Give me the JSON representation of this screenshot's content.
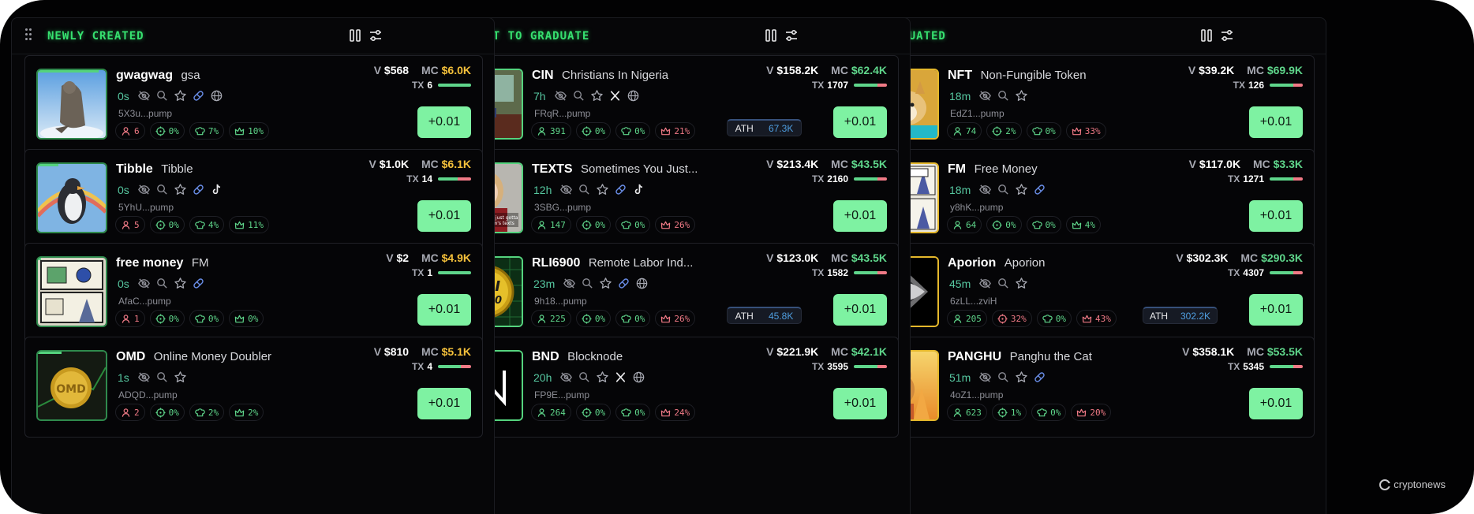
{
  "columns": [
    {
      "title": "NEWLY CREATED",
      "cards": [
        {
          "ticker": "gwagwag",
          "name": "gsa",
          "age": "0s",
          "address": "5X3u...pump",
          "v": "$568",
          "mc": "$6.0K",
          "mc_color": "yellow",
          "tx": "6",
          "tx_buy": 1.0,
          "holders": "6",
          "s1": "0%",
          "s2": "7%",
          "s3": "10%",
          "s3_red": false,
          "holders_red": true,
          "icons": [
            "eye-off",
            "search",
            "star",
            "pill",
            "globe"
          ],
          "buy": "+0.01",
          "thumb": "cat"
        },
        {
          "ticker": "Tibble",
          "name": "Tibble",
          "age": "0s",
          "address": "5YhU...pump",
          "v": "$1.0K",
          "mc": "$6.1K",
          "mc_color": "yellow",
          "tx": "14",
          "tx_buy": 0.6,
          "holders": "5",
          "s1": "0%",
          "s2": "4%",
          "s3": "11%",
          "s3_red": false,
          "holders_red": true,
          "icons": [
            "eye-off",
            "search",
            "star",
            "pill",
            "tiktok"
          ],
          "buy": "+0.01",
          "thumb": "penguin"
        },
        {
          "ticker": "free money",
          "name": "FM",
          "age": "0s",
          "address": "AfaC...pump",
          "v": "$2",
          "mc": "$4.9K",
          "mc_color": "yellow",
          "tx": "1",
          "tx_buy": 1.0,
          "holders": "1",
          "s1": "0%",
          "s2": "0%",
          "s3": "0%",
          "s3_red": false,
          "holders_red": true,
          "icons": [
            "eye-off",
            "search",
            "star",
            "pill"
          ],
          "buy": "+0.01",
          "thumb": "comic"
        },
        {
          "ticker": "OMD",
          "name": "Online Money Doubler",
          "age": "1s",
          "address": "ADQD...pump",
          "v": "$810",
          "mc": "$5.1K",
          "mc_color": "yellow",
          "tx": "4",
          "tx_buy": 0.7,
          "holders": "2",
          "s1": "0%",
          "s2": "2%",
          "s3": "2%",
          "s3_red": false,
          "holders_red": true,
          "icons": [
            "eye-off",
            "search",
            "star"
          ],
          "buy": "+0.01",
          "thumb": "coin"
        }
      ]
    },
    {
      "title": "ABOUT TO GRADUATE",
      "cards": [
        {
          "ticker": "CIN",
          "name": "Christians In Nigeria",
          "age": "7h",
          "address": "FRqR...pump",
          "v": "$158.2K",
          "mc": "$62.4K",
          "mc_color": "green",
          "tx": "1707",
          "tx_buy": 0.72,
          "holders": "391",
          "s1": "0%",
          "s2": "0%",
          "s3": "21%",
          "s3_red": true,
          "holders_red": false,
          "icons": [
            "eye-off",
            "search",
            "star",
            "x",
            "globe"
          ],
          "buy": "+0.01",
          "ath": "67.3K",
          "thumb": "office"
        },
        {
          "ticker": "TEXTS",
          "name": "Sometimes You Just...",
          "age": "12h",
          "address": "3SBG...pump",
          "v": "$213.4K",
          "mc": "$43.5K",
          "mc_color": "green",
          "tx": "2160",
          "tx_buy": 0.72,
          "holders": "147",
          "s1": "0%",
          "s2": "0%",
          "s3": "26%",
          "s3_red": true,
          "holders_red": false,
          "icons": [
            "eye-off",
            "search",
            "star",
            "pill",
            "tiktok"
          ],
          "buy": "+0.01",
          "thumb": "girl"
        },
        {
          "ticker": "RLI6900",
          "name": "Remote Labor Ind...",
          "age": "23m",
          "address": "9h18...pump",
          "v": "$123.0K",
          "mc": "$43.5K",
          "mc_color": "green",
          "tx": "1582",
          "tx_buy": 0.72,
          "holders": "225",
          "s1": "0%",
          "s2": "0%",
          "s3": "26%",
          "s3_red": true,
          "holders_red": false,
          "icons": [
            "eye-off",
            "search",
            "star",
            "pill",
            "globe"
          ],
          "buy": "+0.01",
          "ath": "45.8K",
          "thumb": "rli"
        },
        {
          "ticker": "BND",
          "name": "Blocknode",
          "age": "20h",
          "address": "FP9E...pump",
          "v": "$221.9K",
          "mc": "$42.1K",
          "mc_color": "green",
          "tx": "3595",
          "tx_buy": 0.72,
          "holders": "264",
          "s1": "0%",
          "s2": "0%",
          "s3": "24%",
          "s3_red": true,
          "holders_red": false,
          "icons": [
            "eye-off",
            "search",
            "star",
            "x",
            "globe"
          ],
          "buy": "+0.01",
          "thumb": "bnd"
        }
      ]
    },
    {
      "title": "GRADUATED",
      "cards": [
        {
          "ticker": "NFT",
          "name": "Non-Fungible Token",
          "age": "18m",
          "address": "EdZ1...pump",
          "v": "$39.2K",
          "mc": "$69.9K",
          "mc_color": "green",
          "tx": "126",
          "tx_buy": 0.72,
          "holders": "74",
          "s1": "2%",
          "s2": "0%",
          "s3": "33%",
          "s3_red": true,
          "holders_red": false,
          "icons": [
            "eye-off",
            "search",
            "star"
          ],
          "buy": "+0.01",
          "thumb": "doge"
        },
        {
          "ticker": "FM",
          "name": "Free Money",
          "age": "18m",
          "address": "y8hK...pump",
          "v": "$117.0K",
          "mc": "$3.3K",
          "mc_color": "green",
          "tx": "1271",
          "tx_buy": 0.72,
          "holders": "64",
          "s1": "0%",
          "s2": "0%",
          "s3": "4%",
          "s3_red": false,
          "holders_red": false,
          "icons": [
            "eye-off",
            "search",
            "star",
            "pill"
          ],
          "buy": "+0.01",
          "thumb": "comic2"
        },
        {
          "ticker": "Aporion",
          "name": "Aporion",
          "age": "45m",
          "address": "6zLL...zviH",
          "v": "$302.3K",
          "mc": "$290.3K",
          "mc_color": "green",
          "tx": "4307",
          "tx_buy": 0.72,
          "holders": "205",
          "s1": "32%",
          "s2": "0%",
          "s3": "43%",
          "s3_red": true,
          "s1_red": true,
          "holders_red": false,
          "icons": [
            "eye-off",
            "search",
            "star"
          ],
          "buy": "+0.01",
          "ath": "302.2K",
          "thumb": "eye"
        },
        {
          "ticker": "PANGHU",
          "name": "Panghu the Cat",
          "age": "51m",
          "address": "4oZ1...pump",
          "v": "$358.1K",
          "mc": "$53.5K",
          "mc_color": "green",
          "tx": "5345",
          "tx_buy": 0.72,
          "holders": "623",
          "s1": "1%",
          "s2": "0%",
          "s3": "20%",
          "s3_red": true,
          "holders_red": false,
          "icons": [
            "eye-off",
            "search",
            "star",
            "pill"
          ],
          "buy": "+0.01",
          "thumb": "cat2"
        }
      ]
    }
  ],
  "labels": {
    "v": "V",
    "mc": "MC",
    "tx": "TX",
    "ath": "ATH"
  },
  "watermark": "cryptonews",
  "colors": {
    "accent": "#36e06f",
    "buy_button": "#7ef2a2",
    "mc_new": "#f5c13b",
    "mc_green": "#5fd68b",
    "negative": "#f07a86"
  }
}
